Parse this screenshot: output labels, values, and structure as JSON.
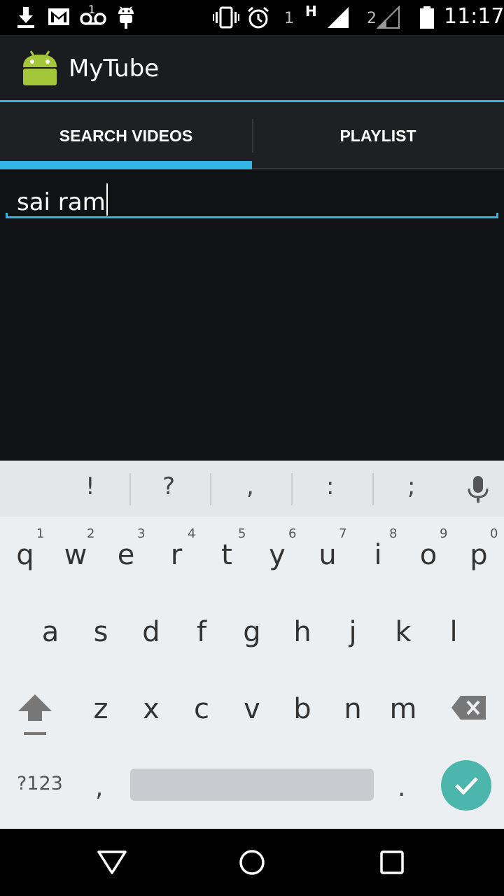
{
  "status_bar": {
    "sim1_label": "1",
    "network_type": "H",
    "sim2_label": "2",
    "voicemail_count": "1",
    "time": "11:17"
  },
  "app": {
    "title": "MyTube",
    "icon": "android-robot-icon"
  },
  "tabs": [
    {
      "label": "SEARCH VIDEOS",
      "selected": true
    },
    {
      "label": "PLAYLIST",
      "selected": false
    }
  ],
  "search": {
    "value": "sai ram"
  },
  "keyboard": {
    "suggestions": [
      "!",
      "?",
      ",",
      ":",
      ";"
    ],
    "row1": [
      "q",
      "w",
      "e",
      "r",
      "t",
      "y",
      "u",
      "i",
      "o",
      "p"
    ],
    "row1_hints": [
      "1",
      "2",
      "3",
      "4",
      "5",
      "6",
      "7",
      "8",
      "9",
      "0"
    ],
    "row2": [
      "a",
      "s",
      "d",
      "f",
      "g",
      "h",
      "j",
      "k",
      "l"
    ],
    "row3": [
      "z",
      "x",
      "c",
      "v",
      "b",
      "n",
      "m"
    ],
    "symbols_label": "?123",
    "comma": ",",
    "period": ".",
    "accent_color": "#4db6ac"
  },
  "colors": {
    "holo_blue": "#33b5e5",
    "background": "#111216"
  }
}
